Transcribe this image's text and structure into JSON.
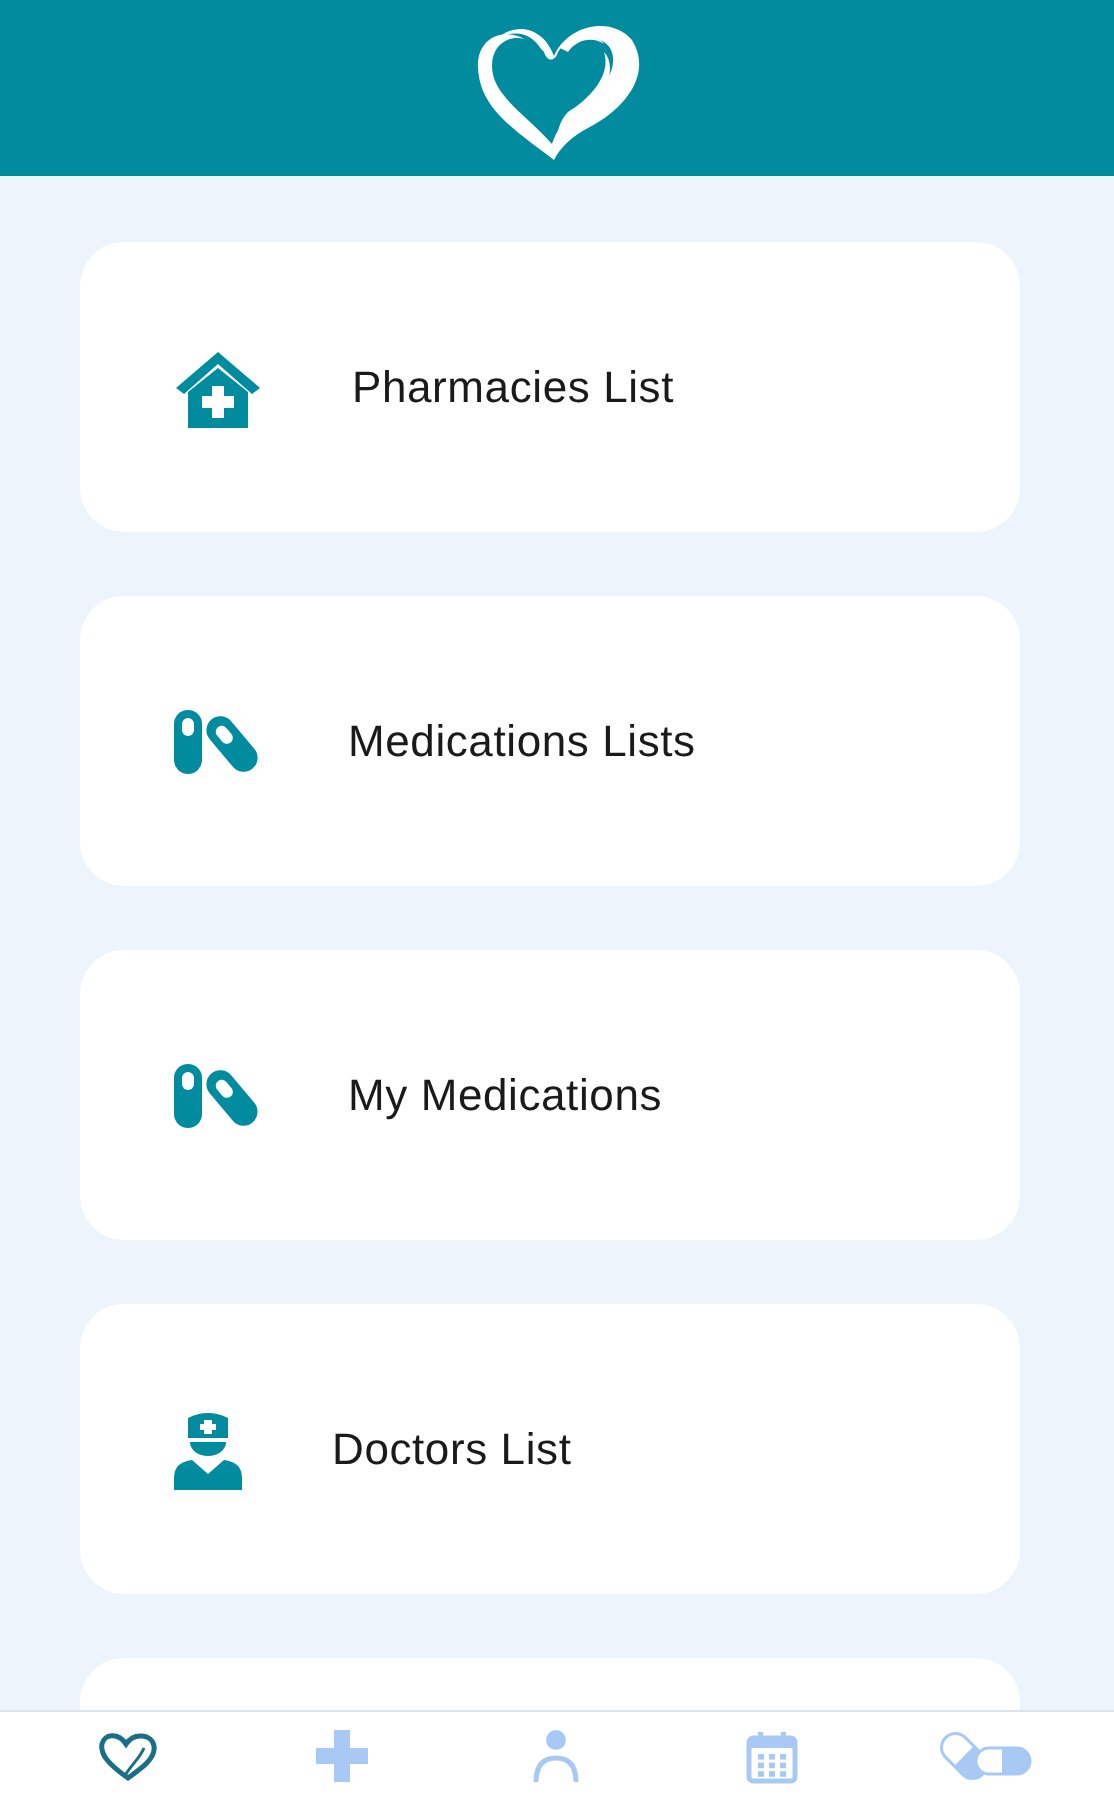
{
  "menu": [
    {
      "label": "Pharmacies List",
      "kind": "pharmacy"
    },
    {
      "label": "Medications Lists",
      "kind": "pills"
    },
    {
      "label": "My Medications",
      "kind": "pills"
    },
    {
      "label": "Doctors List",
      "kind": "doctor"
    }
  ],
  "bottom_nav": [
    {
      "kind": "heart",
      "selected": true
    },
    {
      "kind": "plus",
      "selected": false
    },
    {
      "kind": "person",
      "selected": false
    },
    {
      "kind": "calendar",
      "selected": false
    },
    {
      "kind": "pills",
      "selected": false
    }
  ]
}
